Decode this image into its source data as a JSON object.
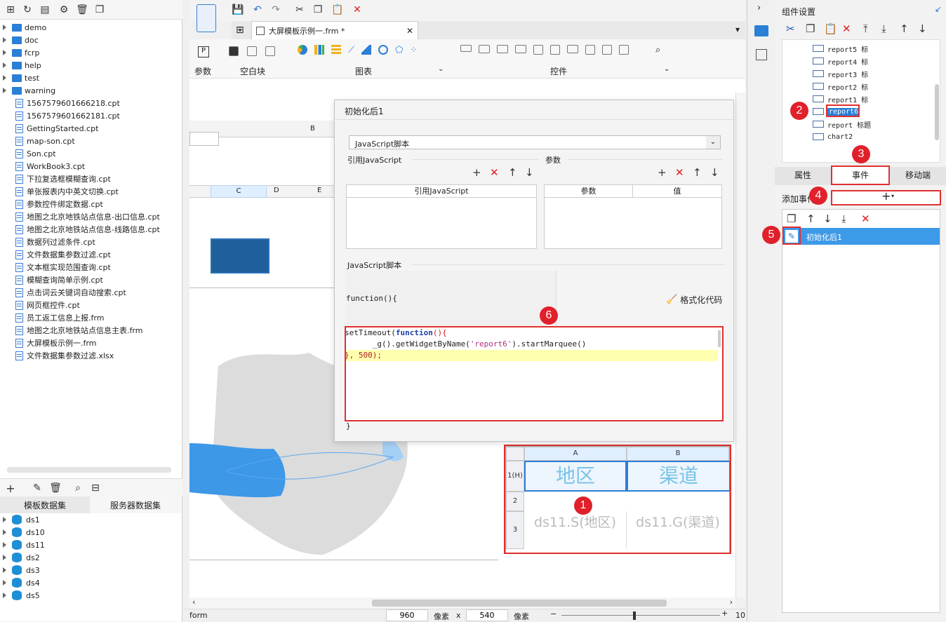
{
  "left_toolbar": {
    "icons": [
      "new-template-icon",
      "refresh-icon",
      "template-icon",
      "settings-icon",
      "delete-icon",
      "copy-icon"
    ]
  },
  "file_tree": {
    "folders": [
      "demo",
      "doc",
      "fcrp",
      "help",
      "test",
      "warning"
    ],
    "files": [
      "1567579601666218.cpt",
      "1567579601662181.cpt",
      "GettingStarted.cpt",
      "map-son.cpt",
      "Son.cpt",
      "WorkBook3.cpt",
      "下拉复选框模糊查询.cpt",
      "单张报表内中英文切换.cpt",
      "参数控件绑定数据.cpt",
      "地图之北京地铁站点信息-出口信息.cpt",
      "地图之北京地铁站点信息-线路信息.cpt",
      "数据列过滤条件.cpt",
      "文件数据集参数过滤.cpt",
      "文本框实现范围查询.cpt",
      "模糊查询简单示例.cpt",
      "点击词云关键词自动搜索.cpt",
      "网页框控件.cpt",
      "员工返工信息上报.frm",
      "地图之北京地铁站点信息主表.frm",
      "大屏模板示例一.frm",
      "文件数据集参数过滤.xlsx"
    ]
  },
  "dataset_panel": {
    "tabs": [
      "模板数据集",
      "服务器数据集"
    ],
    "items": [
      "ds1",
      "ds10",
      "ds11",
      "ds2",
      "ds3",
      "ds4",
      "ds5"
    ]
  },
  "editor_tab": {
    "title": "大屏模板示例一.frm *"
  },
  "ribbon": {
    "groups": [
      "参数",
      "空白块",
      "图表",
      "控件"
    ]
  },
  "dialog": {
    "title": "初始化后1",
    "script_type": "JavaScript脚本",
    "ref_js_label": "引用JavaScript",
    "params_label": "参数",
    "ref_js_col": "引用JavaScript",
    "param_col": "参数",
    "value_col": "值",
    "script_section": "JavaScript脚本",
    "func_head": "function(){",
    "format_label": "格式化代码",
    "code_line1_a": "setTimeout(",
    "code_line1_b": "function",
    "code_line1_c": "(){",
    "code_line2_a": "      _g().getWidgetByName(",
    "code_line2_b": "'report6'",
    "code_line2_c": ").startMarquee()",
    "code_line3": "}, 500);",
    "func_tail": "}"
  },
  "canvas": {
    "sheet_cols": [
      "B"
    ],
    "sheet_cols2": [
      "C",
      "D",
      "E"
    ],
    "report_cols": [
      "A",
      "B"
    ],
    "report_rows": [
      "1(H)",
      "2",
      "3"
    ],
    "report_h1": "地区",
    "report_h2": "渠道",
    "report_c1": "ds11.S(地区)",
    "report_c2": "ds11.G(渠道)"
  },
  "status_bar": {
    "form": "form",
    "width": "960",
    "unit1": "像素",
    "x": "x",
    "height": "540",
    "unit2": "像素",
    "zoom": "10"
  },
  "right_panel": {
    "title": "组件设置",
    "components": [
      "report5 标",
      "report4 标",
      "report3 标",
      "report2 标",
      "report1 标",
      "report6",
      "report 标题",
      "chart2"
    ],
    "tabs": [
      "属性",
      "事件",
      "移动端"
    ],
    "add_event_label": "添加事件",
    "event_item": "初始化后1"
  },
  "annotations": [
    "1",
    "2",
    "3",
    "4",
    "5",
    "6"
  ]
}
